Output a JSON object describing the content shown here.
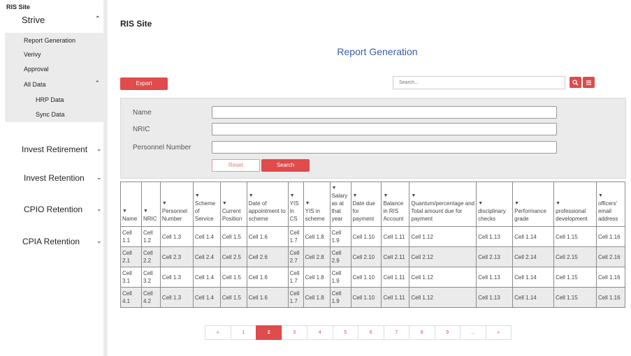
{
  "sidebar": {
    "site": "RIS Site",
    "strive": "Strive",
    "submenu": {
      "report_generation": "Report Generation",
      "verivy": "Verivy",
      "approval": "Approval",
      "all_data": "All Data",
      "hrp_data": "HRP Data",
      "sync_data": "Sync Data"
    },
    "menu": {
      "invest_retirement": "Invest Retirement",
      "invest_retention": "Invest Retention",
      "cpio_retention": "CPIO Retention",
      "cpia_retention": "CPIA Retention"
    }
  },
  "header": {
    "site_title": "RIS Site",
    "report_title": "Report Generation"
  },
  "toolbar": {
    "export_label": "Export",
    "search_placeholder": "Search..."
  },
  "filters": {
    "name_label": "Name",
    "nric_label": "NRIC",
    "personnel_label": "Personnel Number",
    "reset_label": "Reset",
    "search_label": "Search"
  },
  "table": {
    "sort_glyph": "▼",
    "headers": [
      "Name",
      "NRIC",
      "Personnel Number",
      "Scheme of Service",
      "Current Position",
      "Date of appointment to scheme",
      "YIS in CS",
      "YIS in scheme",
      "Salary as at that year",
      "Date due for payment",
      "Balance in RIS Account",
      "Quantum/percentage and Total amount due for payment",
      "disciplinary checks",
      "Performance grade",
      "professional development",
      "officers' email address"
    ],
    "rows": [
      [
        "Cell 1.1",
        "Cell 1.2",
        "Cell 1.3",
        "Cell 1.4",
        "Cell 1.5",
        "Cell 1.6",
        "Cell 1.7",
        "Cell 1.8",
        "Cell 1.9",
        "Cell 1.10",
        "Cell 1.11",
        "Cell 1.12",
        "Cell 1.13",
        "Cell 1.14",
        "Cell 1.15",
        "Cell 1.16"
      ],
      [
        "Cell 2.1",
        "Cell 2.2",
        "Cell 2.3",
        "Cell 2.4",
        "Cell 2.5",
        "Cell 2.6",
        "Cell 2.7",
        "Cell 2.8",
        "Cell 2.9",
        "Cell 2.10",
        "Cell 2.11",
        "Cell 2.12",
        "Cell 2.13",
        "Cell 2.14",
        "Cell 2.15",
        "Cell 2.16"
      ],
      [
        "Cell 3.1",
        "Cell 3.2",
        "Cell 1.3",
        "Cell 1.4",
        "Cell 1.5",
        "Cell 1.6",
        "Cell 1.7",
        "Cell 1.8",
        "Cell 1.9",
        "Cell 1.10",
        "Cell 1.11",
        "Cell 1.12",
        "Cell 1.13",
        "Cell 1.14",
        "Cell 1.15",
        "Cell 1.16"
      ],
      [
        "Cell 4.1",
        "Cell 4.2",
        "Cell 1.3",
        "Cell 1.4",
        "Cell 1.5",
        "Cell 1.6",
        "Cell 1.7",
        "Cell 1.8",
        "Cell 1.9",
        "Cell 1.10",
        "Cell 1.11",
        "Cell 1.12",
        "Cell 1.13",
        "Cell 1.14",
        "Cell 1.15",
        "Cell 1.16"
      ]
    ]
  },
  "pagination": {
    "active": "2",
    "pages": [
      "«",
      "1",
      "2",
      "3",
      "4",
      "5",
      "6",
      "7",
      "8",
      "9",
      "...",
      "»"
    ]
  },
  "colors": {
    "accent": "#e04b4b",
    "title_blue": "#3a5dab",
    "panel_gray": "#ebebeb"
  }
}
